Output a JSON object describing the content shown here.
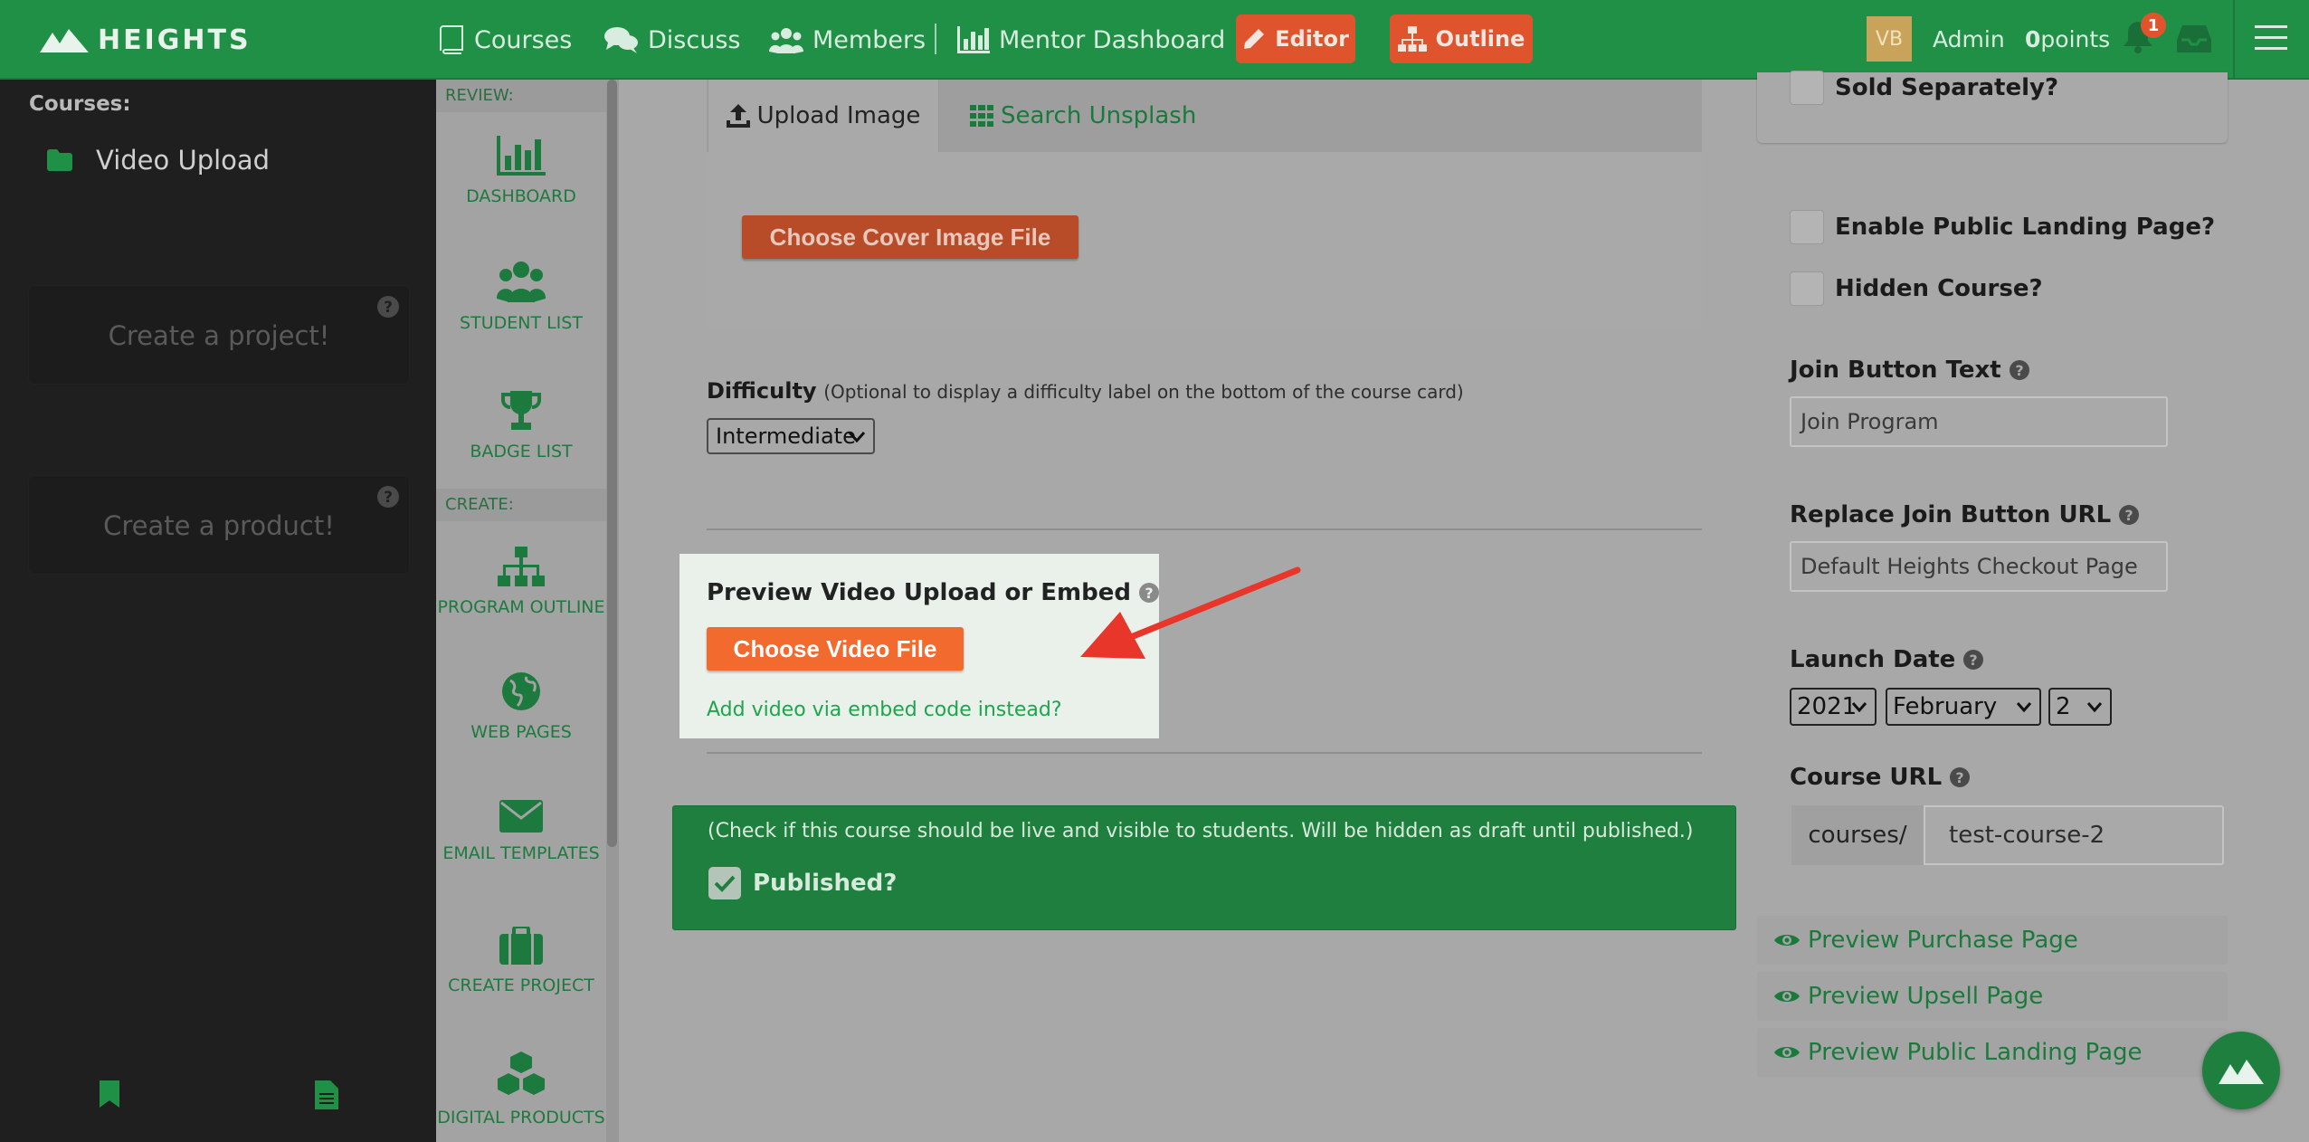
{
  "topbar": {
    "brand": "HEIGHTS",
    "nav": {
      "courses": "Courses",
      "discuss": "Discuss",
      "members": "Members",
      "mentor_dashboard": "Mentor Dashboard"
    },
    "editor_button": "Editor",
    "outline_button": "Outline",
    "avatar_initials": "VB",
    "user_role": "Admin",
    "points_value": "0",
    "points_unit": "points",
    "notification_count": "1",
    "accent_color": "#219047",
    "button_color": "#e0542d"
  },
  "left_sidebar": {
    "heading": "Courses:",
    "course_item": "Video Upload",
    "create_project_prompt": "Create a project!",
    "create_product_prompt": "Create a product!"
  },
  "tool_column": {
    "review_section": "REVIEW:",
    "create_section": "CREATE:",
    "items": {
      "dashboard": "DASHBOARD",
      "student_list": "STUDENT LIST",
      "badge_list": "BADGE LIST",
      "program_outline": "PROGRAM OUTLINE",
      "web_pages": "WEB PAGES",
      "email_templates": "EMAIL TEMPLATES",
      "create_project": "CREATE PROJECT",
      "digital_products": "DIGITAL PRODUCTS"
    }
  },
  "main": {
    "tabs": {
      "upload_image": "Upload Image",
      "search_unsplash": "Search Unsplash"
    },
    "choose_cover_button": "Choose Cover Image File",
    "difficulty": {
      "label": "Difficulty",
      "hint": "(Optional to display a difficulty label on the bottom of the course card)",
      "selected": "Intermediate"
    },
    "preview_video": {
      "title": "Preview Video Upload or Embed",
      "choose_button": "Choose Video File",
      "embed_link": "Add video via embed code instead?"
    },
    "publish": {
      "note": "(Check if this course should be live and visible to students. Will be hidden as draft until published.)",
      "label": "Published?",
      "checked": true
    }
  },
  "right_panel": {
    "sold_separately": "Sold Separately?",
    "enable_landing": "Enable Public Landing Page?",
    "hidden_course": "Hidden Course?",
    "join_button_text": {
      "label": "Join Button Text",
      "placeholder": "Join Program"
    },
    "replace_join_url": {
      "label": "Replace Join Button URL",
      "placeholder": "Default Heights Checkout Page"
    },
    "launch_date": {
      "label": "Launch Date",
      "year": "2021",
      "month": "February",
      "day": "2"
    },
    "course_url": {
      "label": "Course URL",
      "prefix": "courses/",
      "slug": "test-course-2"
    },
    "preview_links": {
      "purchase": "Preview Purchase Page",
      "upsell": "Preview Upsell Page",
      "landing": "Preview Public Landing Page"
    }
  }
}
